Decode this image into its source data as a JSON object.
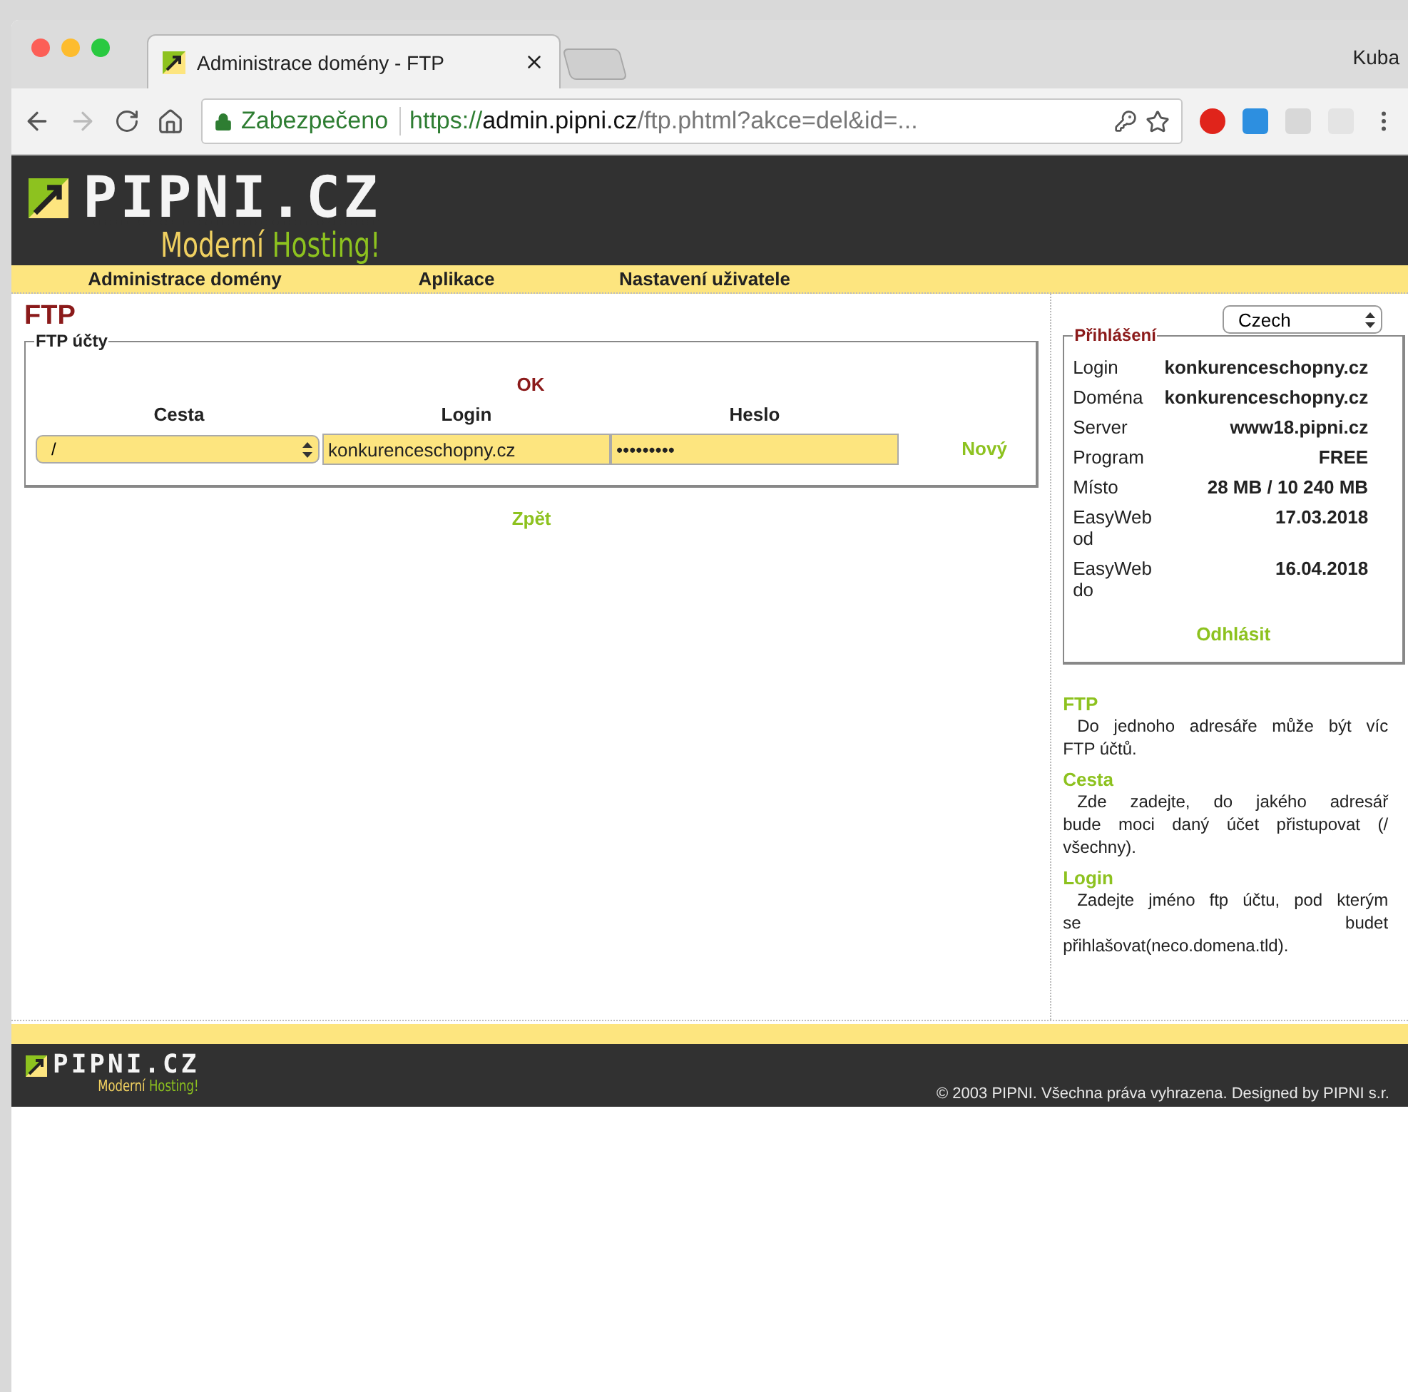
{
  "browser": {
    "tab_title": "Administrace domény - FTP",
    "profile": "Kuba",
    "security": "Zabezpečeno",
    "url_scheme": "https://",
    "url_host": "admin.pipni.cz",
    "url_path": "/ftp.phtml?akce=del&id=..."
  },
  "header": {
    "logo": "PIPNI.CZ",
    "tagline_1": "Moderní",
    "tagline_2": "Hosting!"
  },
  "nav": [
    "Administrace domény",
    "Aplikace",
    "Nastavení uživatele"
  ],
  "main": {
    "title": "FTP",
    "legend": "FTP účty",
    "status": "OK",
    "columns": [
      "Cesta",
      "Login",
      "Heslo"
    ],
    "row": {
      "path": "/",
      "login": "konkurenceschopny.cz",
      "password": "•••••••••",
      "action": "Nový"
    },
    "back": "Zpět"
  },
  "sidebar": {
    "language": "Czech",
    "legend": "Přihlášení",
    "info": [
      {
        "label": "Login",
        "value": "konkurenceschopny.cz"
      },
      {
        "label": "Doména",
        "value": "konkurenceschopny.cz"
      },
      {
        "label": "Server",
        "value": "www18.pipni.cz"
      },
      {
        "label": "Program",
        "value": "FREE"
      },
      {
        "label": "Místo",
        "value": "28 MB / 10 240 MB"
      },
      {
        "label": "EasyWeb od",
        "value": "17.03.2018"
      },
      {
        "label": "EasyWeb do",
        "value": "16.04.2018"
      }
    ],
    "logout": "Odhlásit",
    "help": [
      {
        "title": "FTP",
        "lines": [
          "Do jednoho adresáře může být víc",
          "FTP účtů."
        ]
      },
      {
        "title": "Cesta",
        "lines": [
          "Zde zadejte, do jakého adresář",
          "bude moci daný účet přistupovat (/",
          "všechny)."
        ]
      },
      {
        "title": "Login",
        "lines": [
          "Zadejte jméno ftp účtu, pod kterým",
          "se budet",
          "přihlašovat(neco.domena.tld)."
        ]
      }
    ]
  },
  "footer": {
    "logo": "PIPNI.CZ",
    "tagline_1": "Moderní",
    "tagline_2": "Hosting!",
    "copyright": "© 2003 PIPNI. Všechna práva vyhrazena. Designed by PIPNI s.r."
  }
}
